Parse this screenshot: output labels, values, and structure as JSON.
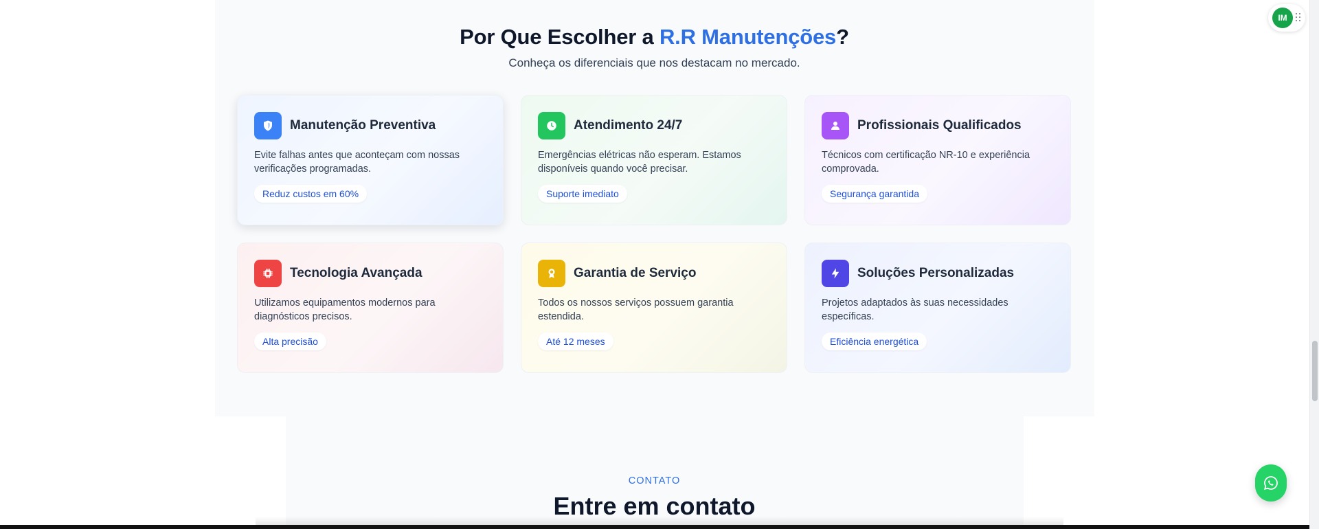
{
  "section": {
    "title_prefix": "Por Que Escolher a ",
    "title_brand": "R.R Manutenções",
    "title_suffix": "?",
    "subtitle": "Conheça os diferenciais que nos destacam no mercado."
  },
  "features": [
    {
      "title": "Manutenção Preventiva",
      "description": "Evite falhas antes que aconteçam com nossas verificações programadas.",
      "badge": "Reduz custos em 60%",
      "icon": "shield-icon",
      "color": "#3b82f6"
    },
    {
      "title": "Atendimento 24/7",
      "description": "Emergências elétricas não esperam. Estamos disponíveis quando você precisar.",
      "badge": "Suporte imediato",
      "icon": "clock-icon",
      "color": "#22c55e"
    },
    {
      "title": "Profissionais Qualificados",
      "description": "Técnicos com certificação NR-10 e experiência comprovada.",
      "badge": "Segurança garantida",
      "icon": "user-icon",
      "color": "#a855f7"
    },
    {
      "title": "Tecnologia Avançada",
      "description": "Utilizamos equipamentos modernos para diagnósticos precisos.",
      "badge": "Alta precisão",
      "icon": "cpu-icon",
      "color": "#ef4444"
    },
    {
      "title": "Garantia de Serviço",
      "description": "Todos os nossos serviços possuem garantia estendida.",
      "badge": "Até 12 meses",
      "icon": "award-icon",
      "color": "#eab308"
    },
    {
      "title": "Soluções Personalizadas",
      "description": "Projetos adaptados às suas necessidades específicas.",
      "badge": "Eficiência energética",
      "icon": "lightning-icon",
      "color": "#4f46e5"
    }
  ],
  "contact": {
    "eyebrow": "CONTATO",
    "title": "Entre em contato"
  },
  "extension": {
    "avatar_text": "IM"
  },
  "floating": {
    "icon": "whatsapp-icon",
    "color": "#25d366"
  },
  "colors": {
    "brand_accent": "#2f6fe4",
    "badge_text": "#1d4ed8"
  }
}
